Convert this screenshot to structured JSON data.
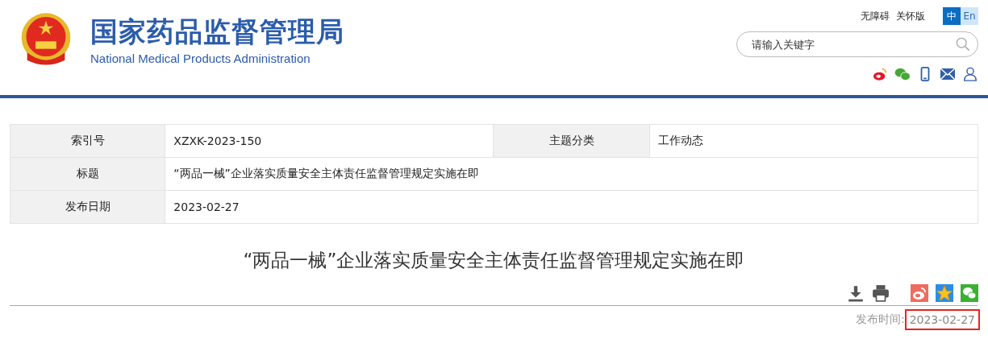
{
  "header": {
    "title": "国家药品监督管理局",
    "subtitle": "National Medical Products Administration",
    "links": [
      "无障碍",
      "关怀版"
    ],
    "languages": [
      {
        "label": "中",
        "selected": true
      },
      {
        "label": "En",
        "selected": false
      }
    ],
    "search": {
      "placeholder": "请输入关键字"
    }
  },
  "info_table": {
    "rows": [
      {
        "label": "索引号",
        "value": "XZXK-2023-150",
        "label_2": "主题分类",
        "value_2": "工作动态"
      },
      {
        "label": "标题",
        "value": "“两品一械”企业落实质量安全主体责任监督管理规定实施在即"
      },
      {
        "label": "发布日期",
        "value": "2023-02-27"
      }
    ]
  },
  "article": {
    "title": "“两品一械”企业落实质量安全主体责任监督管理规定实施在即",
    "date_label": "发布时间:",
    "date": "2023-02-27",
    "date_highlighted": true
  }
}
